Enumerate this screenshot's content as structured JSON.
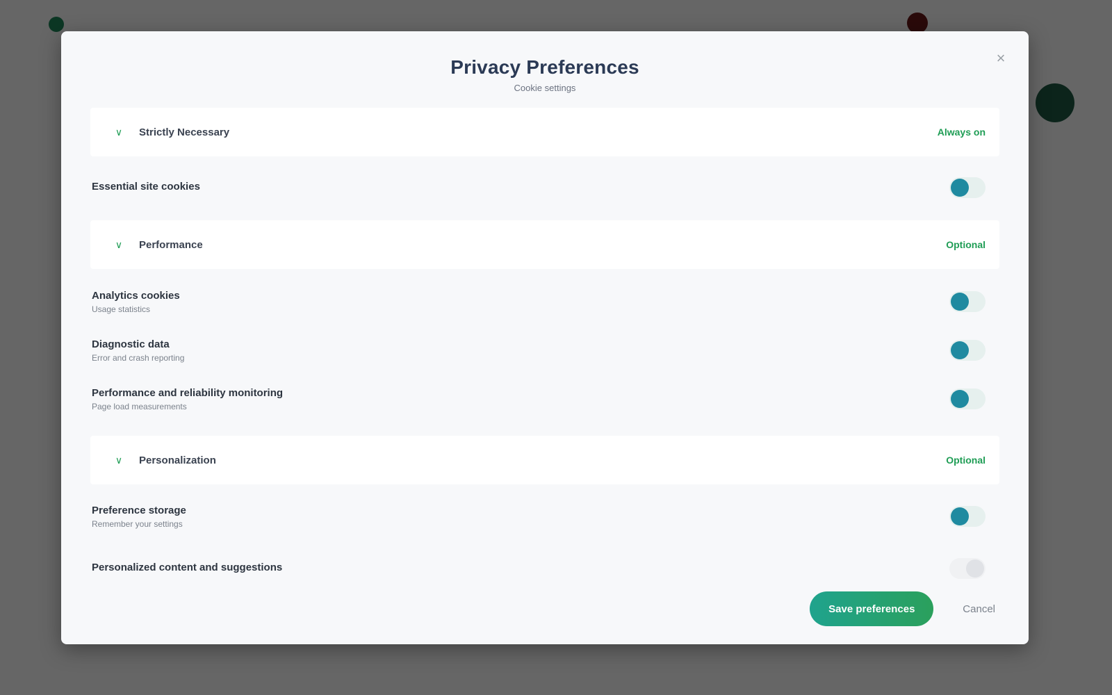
{
  "background": {
    "brand": "",
    "nav": "",
    "links": [],
    "sidebar": []
  },
  "modal": {
    "title": "Privacy Preferences",
    "subtitle": "Cookie settings",
    "close_icon": "close-icon",
    "sections": [
      {
        "title": "Strictly Necessary",
        "status": "Always on",
        "items": [
          {
            "label": "Essential site cookies",
            "desc": "",
            "enabled": true
          }
        ]
      },
      {
        "title": "Performance",
        "status": "Optional",
        "items": [
          {
            "label": "Analytics cookies",
            "desc": "Usage statistics",
            "enabled": true
          },
          {
            "label": "Diagnostic data",
            "desc": "Error and crash reporting",
            "enabled": true
          },
          {
            "label": "Performance and reliability monitoring",
            "desc": "Page load measurements",
            "enabled": true
          }
        ]
      },
      {
        "title": "Personalization",
        "status": "Optional",
        "items": [
          {
            "label": "Preference storage",
            "desc": "Remember your settings",
            "enabled": true
          },
          {
            "label": "Personalized content and suggestions",
            "desc": "",
            "enabled": false
          }
        ]
      }
    ],
    "save_label": "Save preferences",
    "cancel_label": "Cancel"
  }
}
